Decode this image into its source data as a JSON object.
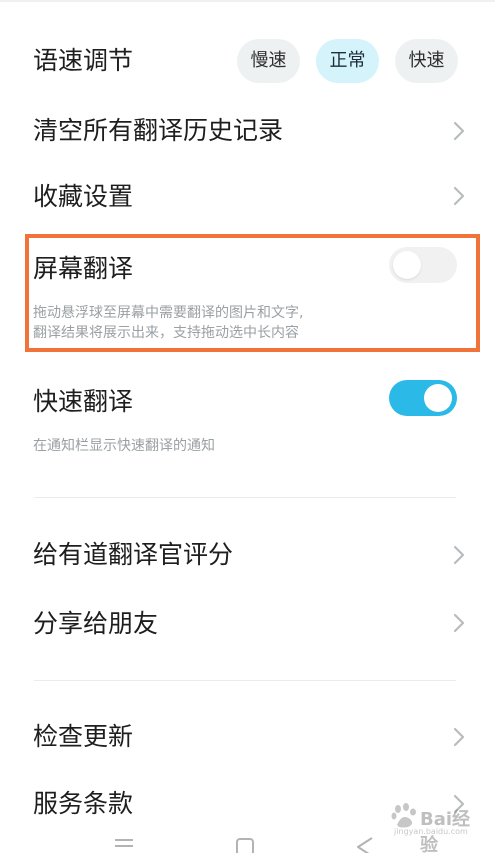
{
  "speed": {
    "label": "语速调节",
    "options": [
      "慢速",
      "正常",
      "快速"
    ],
    "selected": "正常"
  },
  "clear_history": {
    "label": "清空所有翻译历史记录"
  },
  "favorites": {
    "label": "收藏设置"
  },
  "screen_translate": {
    "label": "屏幕翻译",
    "desc_line1": "拖动悬浮球至屏幕中需要翻译的图片和文字,",
    "desc_line2": "翻译结果将展示出来，支持拖动选中长内容",
    "enabled": false
  },
  "quick_translate": {
    "label": "快速翻译",
    "desc": "在通知栏显示快速翻译的通知",
    "enabled": true
  },
  "rate": {
    "label": "给有道翻译官评分"
  },
  "share": {
    "label": "分享给朋友"
  },
  "check_update": {
    "label": "检查更新"
  },
  "terms": {
    "label": "服务条款"
  },
  "watermark": {
    "text": "Bai经验",
    "sub": "jingyan.baidu.com"
  },
  "colors": {
    "accent": "#2bb9e8",
    "highlight_border": "#f2733a",
    "selected_chip": "#d4f3fb"
  }
}
